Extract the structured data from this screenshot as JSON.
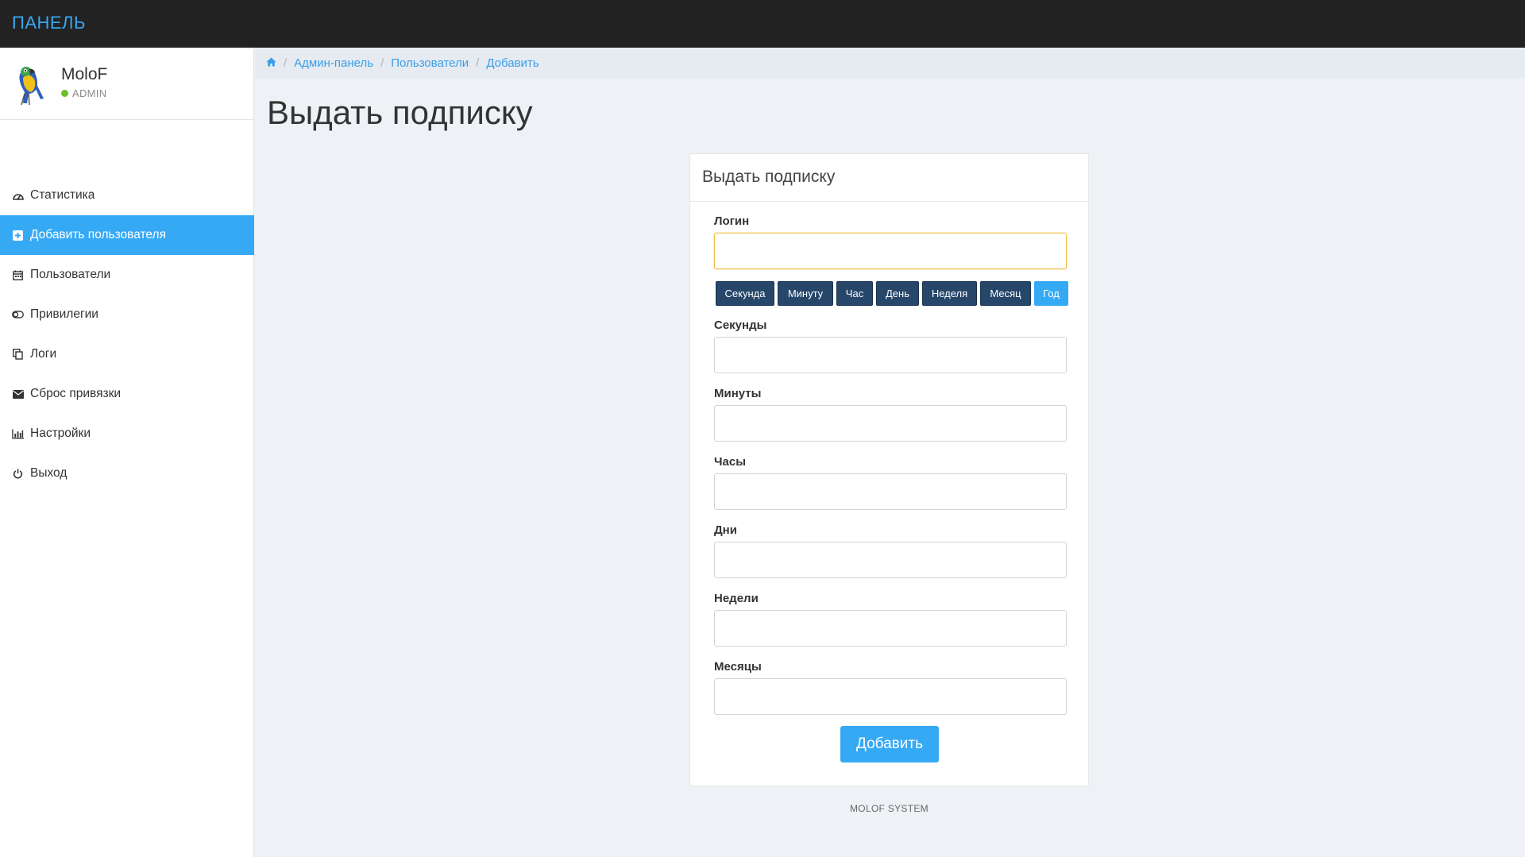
{
  "app": {
    "brand": "ПАНЕЛЬ"
  },
  "user": {
    "name": "MoloF",
    "role": "ADMIN",
    "avatar_icon": "parrot-avatar"
  },
  "sidebar": {
    "items": [
      {
        "label": "Статистика",
        "icon": "dashboard-icon",
        "active": false
      },
      {
        "label": "Добавить пользователя",
        "icon": "plus-square-icon",
        "active": true
      },
      {
        "label": "Пользователи",
        "icon": "calendar-icon",
        "active": false
      },
      {
        "label": "Привилегии",
        "icon": "toggle-icon",
        "active": false
      },
      {
        "label": "Логи",
        "icon": "copy-icon",
        "active": false
      },
      {
        "label": "Сброс привязки",
        "icon": "envelope-icon",
        "active": false
      },
      {
        "label": "Настройки",
        "icon": "bar-chart-icon",
        "active": false
      },
      {
        "label": "Выход",
        "icon": "power-icon",
        "active": false
      }
    ]
  },
  "breadcrumb": {
    "home_icon": "home-icon",
    "items": [
      "Админ-панель",
      "Пользователи",
      "Добавить"
    ]
  },
  "page": {
    "title": "Выдать подписку"
  },
  "form": {
    "title": "Выдать подписку",
    "login_label": "Логин",
    "login_value": "",
    "units": [
      "Секунда",
      "Минуту",
      "Час",
      "День",
      "Неделя",
      "Месяц",
      "Год"
    ],
    "selected_unit": "Год",
    "fields": [
      {
        "label": "Секунды",
        "value": ""
      },
      {
        "label": "Минуты",
        "value": ""
      },
      {
        "label": "Часы",
        "value": ""
      },
      {
        "label": "Дни",
        "value": ""
      },
      {
        "label": "Недели",
        "value": ""
      },
      {
        "label": "Месяцы",
        "value": ""
      }
    ],
    "submit_label": "Добавить"
  },
  "footer": {
    "text": "MOLOF SYSTEM"
  },
  "colors": {
    "accent": "#36a9f5",
    "topbar": "#222222",
    "unit_button": "#26466a",
    "status": "#6bbf2a"
  }
}
